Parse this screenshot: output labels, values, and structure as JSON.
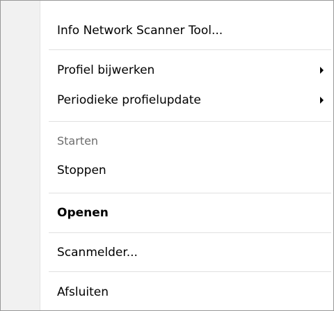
{
  "menu": {
    "items": [
      {
        "label": "Info Network Scanner Tool..."
      },
      {
        "label": "Profiel bijwerken",
        "submenu": true
      },
      {
        "label": "Periodieke profielupdate",
        "submenu": true
      },
      {
        "label": "Starten",
        "disabled": true
      },
      {
        "label": "Stoppen"
      },
      {
        "label": "Openen",
        "bold": true
      },
      {
        "label": "Scanmelder..."
      },
      {
        "label": "Afsluiten"
      }
    ]
  },
  "icons": {
    "submenu_arrow": "chevron-right-icon"
  },
  "colors": {
    "border": "#979797",
    "gutter": "#f1f1f1",
    "separator": "#e0e0e0",
    "disabled_text": "#6d6d6d"
  }
}
